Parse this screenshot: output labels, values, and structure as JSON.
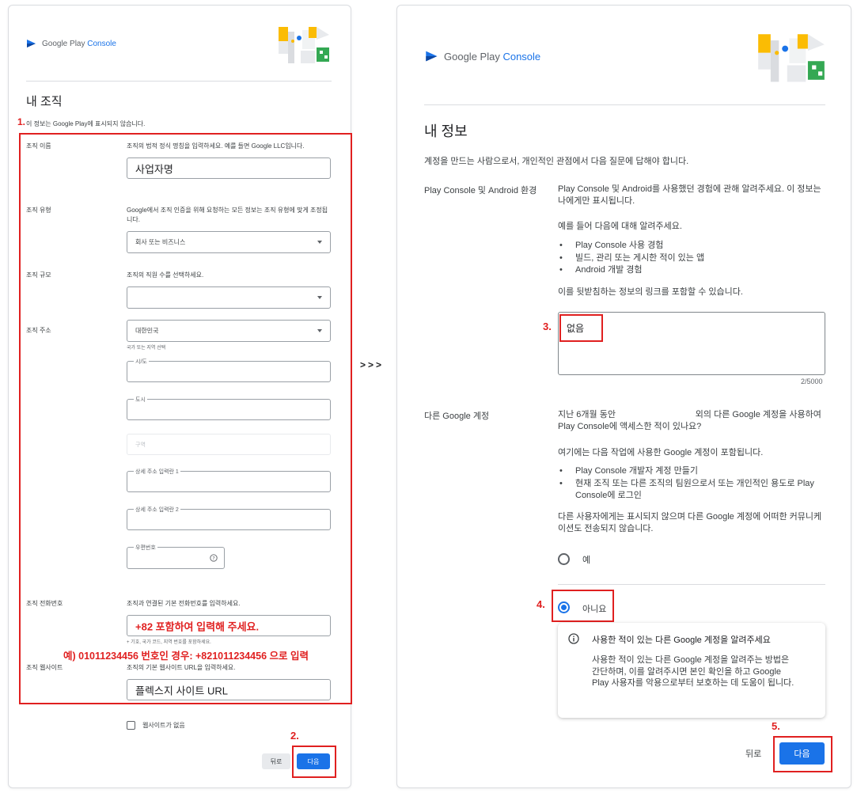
{
  "left": {
    "logo": {
      "brand": "Google Play",
      "product": "Console"
    },
    "title": "내 조직",
    "subtitle": "이 정보는 Google Play에 표시되지 않습니다.",
    "org_name": {
      "label": "조직 이름",
      "desc": "조직의 법적 정식 명칭을 입력하세요. 예를 들면 Google LLC입니다.",
      "value": "사업자명"
    },
    "org_type": {
      "label": "조직 유형",
      "desc": "Google에서 조직 인증을 위해 요청하는 모든 정보는 조직 유형에 맞게 조정됩니다.",
      "value": "회사 또는 비즈니스"
    },
    "org_size": {
      "label": "조직 규모",
      "desc": "조직의 직원 수를 선택하세요.",
      "value": ""
    },
    "org_address": {
      "label": "조직 주소",
      "country": "대한민국",
      "country_hint": "국가 또는 지역 선택",
      "province": "시/도",
      "city": "도시",
      "district": "구역",
      "address1": "상세 주소 입력란 1",
      "address2": "상세 주소 입력란 2",
      "postal": "우편번호"
    },
    "org_phone": {
      "label": "조직 전화번호",
      "desc": "조직과 연결된 기본 전화번호를 입력하세요.",
      "value": "+82 포함하여 입력해 주세요.",
      "hint": "+ 기호, 국가 코드, 지역 번호를 포함하세요."
    },
    "phone_example": "예) 01011234456 번호인 경우: +821011234456 으로 입력",
    "org_website": {
      "label": "조직 웹사이트",
      "desc": "조직의 기본 웹사이트 URL을 입력하세요.",
      "value": "플렉스지 사이트 URL"
    },
    "no_website": "웹사이트가 없음",
    "back": "뒤로",
    "next": "다음",
    "step1": "1.",
    "step2": "2."
  },
  "arrow": ">>>",
  "right": {
    "logo": {
      "brand": "Google Play",
      "product": "Console"
    },
    "title": "내 정보",
    "intro": "계정을 만드는 사람으로서, 개인적인 관점에서 다음 질문에 답해야 합니다.",
    "env_label": "Play Console 및 Android 환경",
    "env_desc1": "Play Console 및 Android를 사용했던 경험에 관해 알려주세요. 이 정보는 나에게만 표시됩니다.",
    "env_desc2": "예를 들어 다음에 대해 알려주세요.",
    "env_items": [
      "Play Console 사용 경험",
      "빌드, 관리 또는 게시한 적이 있는 앱",
      "Android 개발 경험"
    ],
    "env_desc3": "이를 뒷받침하는 정보의 링크를 포함할 수 있습니다.",
    "env_value": "없음",
    "counter": "2/5000",
    "other_label": "다른 Google 계정",
    "other_q": "지난 6개월 동안                                 외의 다른 Google 계정을 사용하여 Play Console에 액세스한 적이 있나요?",
    "other_desc": "여기에는 다음 작업에 사용한 Google 계정이 포함됩니다.",
    "other_items": [
      "Play Console 개발자 계정 만들기",
      "현재 조직 또는 다른 조직의 팀원으로서 또는 개인적인 용도로 Play Console에 로그인"
    ],
    "other_note": "다른 사용자에게는 표시되지 않으며 다른 Google 계정에 어떠한 커뮤니케이션도 전송되지 않습니다.",
    "yes": "예",
    "no": "아니요",
    "info_title": "사용한 적이 있는 다른 Google 계정을 알려주세요",
    "info_body": "사용한 적이 있는 다른 Google 계정을 알려주는 방법은 간단하며, 이를 알려주시면 본인 확인을 하고 Google Play 사용자를 악용으로부터 보호하는 데 도움이 됩니다.",
    "back": "뒤로",
    "next": "다음",
    "step3": "3.",
    "step4": "4.",
    "step5": "5."
  }
}
